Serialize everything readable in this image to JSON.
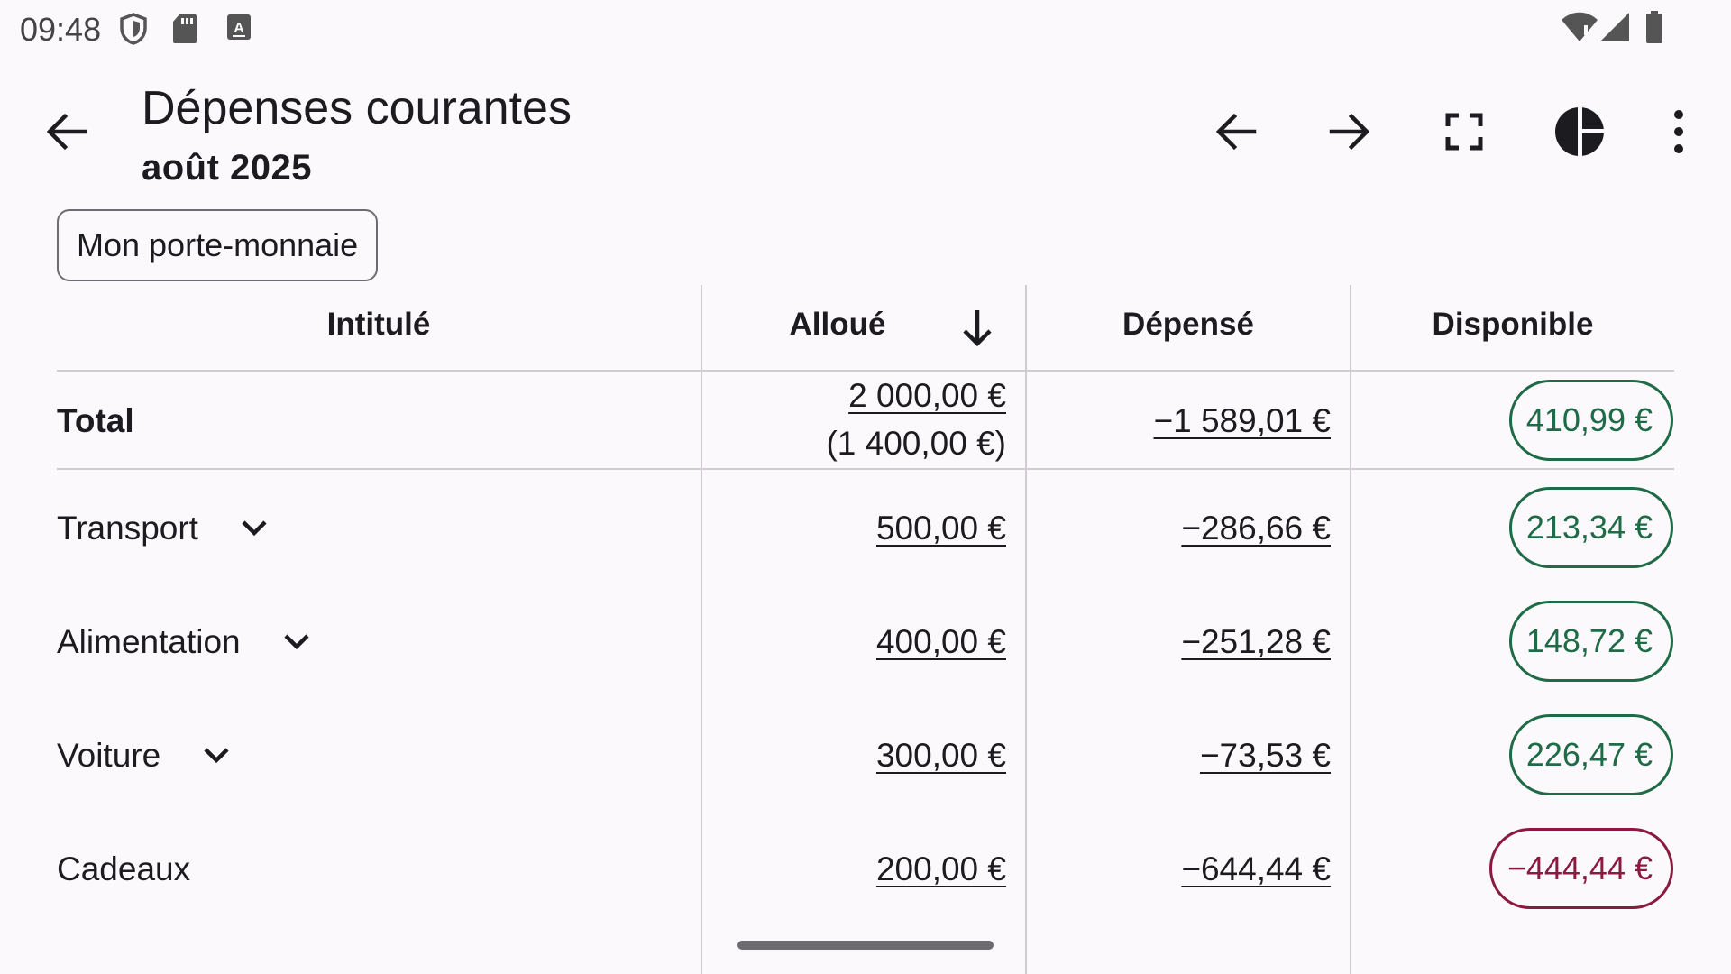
{
  "status_bar": {
    "time": "09:48",
    "left_icons": [
      "shield-icon",
      "sd-card-icon",
      "keyboard-a-icon"
    ],
    "right_icons": [
      "wifi-icon",
      "signal-icon",
      "battery-icon"
    ]
  },
  "app_bar": {
    "title": "Dépenses courantes",
    "subtitle": "août 2025",
    "actions": [
      "arrow-left-icon",
      "arrow-right-icon",
      "fullscreen-icon",
      "pie-chart-icon",
      "more-vert-icon"
    ]
  },
  "filter_chip": {
    "label": "Mon porte-monnaie"
  },
  "table": {
    "headers": {
      "label": "Intitulé",
      "allocated": "Alloué",
      "spent": "Dépensé",
      "available": "Disponible"
    },
    "sort_icon": "arrow-down-icon",
    "total": {
      "label": "Total",
      "allocated": "2 000,00 €",
      "allocated_sub": "(1 400,00 €)",
      "spent": "−1 589,01 €",
      "available": "410,99 €"
    },
    "rows": [
      {
        "label": "Transport",
        "allocated": "500,00 €",
        "spent": "−286,66 €",
        "available": "213,34 €",
        "expandable": true,
        "negative": false
      },
      {
        "label": "Alimentation",
        "allocated": "400,00 €",
        "spent": "−251,28 €",
        "available": "148,72 €",
        "expandable": true,
        "negative": false
      },
      {
        "label": "Voiture",
        "allocated": "300,00 €",
        "spent": "−73,53 €",
        "available": "226,47 €",
        "expandable": true,
        "negative": false
      },
      {
        "label": "Cadeaux",
        "allocated": "200,00 €",
        "spent": "−644,44 €",
        "available": "−444,44 €",
        "expandable": false,
        "negative": true
      }
    ]
  },
  "colors": {
    "positive": "#1f6b47",
    "negative": "#8b1a3f",
    "background": "#fbf9fc"
  }
}
